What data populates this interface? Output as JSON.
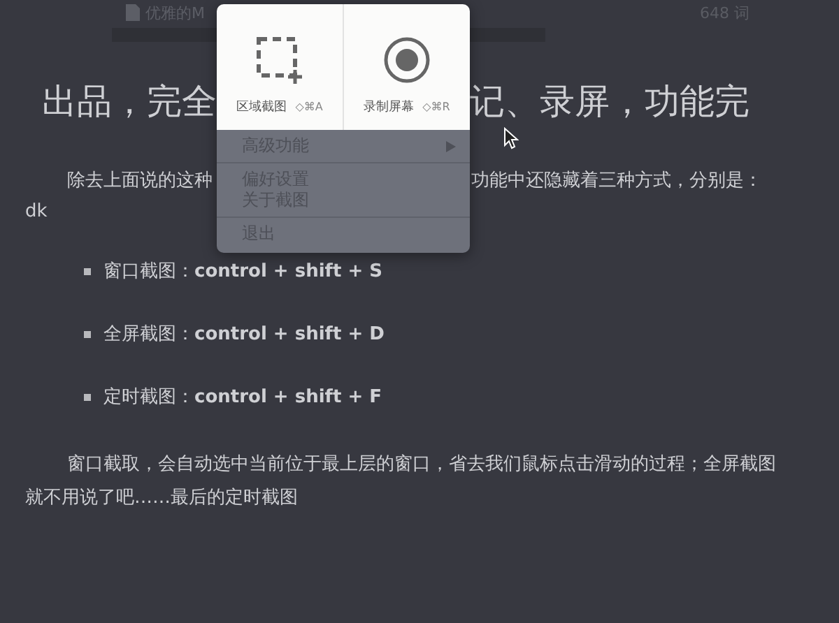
{
  "document": {
    "title": "优雅的M",
    "word_count": "648 词",
    "heading": [
      "出品，完全",
      "记、录屏，功能完"
    ],
    "paragraph_1": [
      "除去上面说的这种",
      "功能中还隐藏着三种方式，分别是："
    ],
    "line_2": "dk",
    "bullets": [
      {
        "label": "窗口截图：",
        "keys": "control + shift + S"
      },
      {
        "label": "全屏截图：",
        "keys": "control + shift + D"
      },
      {
        "label": "定时截图：",
        "keys": "control + shift + F"
      }
    ],
    "paragraph_2": "窗口截取，会自动选中当前位于最上层的窗口，省去我们鼠标点击滑动的过程；全屏截图就不用说了吧……最后的定时截图"
  },
  "popup": {
    "actions": [
      {
        "kind": "region",
        "label": "区域截图",
        "shortcut": "◇⌘A"
      },
      {
        "kind": "record",
        "label": "录制屏幕",
        "shortcut": "◇⌘R"
      }
    ],
    "menu": [
      [
        {
          "label": "高级功能",
          "submenu": true
        }
      ],
      [
        {
          "label": "偏好设置",
          "submenu": false
        },
        {
          "label": "关于截图",
          "submenu": false
        }
      ],
      [
        {
          "label": "退出",
          "submenu": false
        }
      ]
    ]
  }
}
